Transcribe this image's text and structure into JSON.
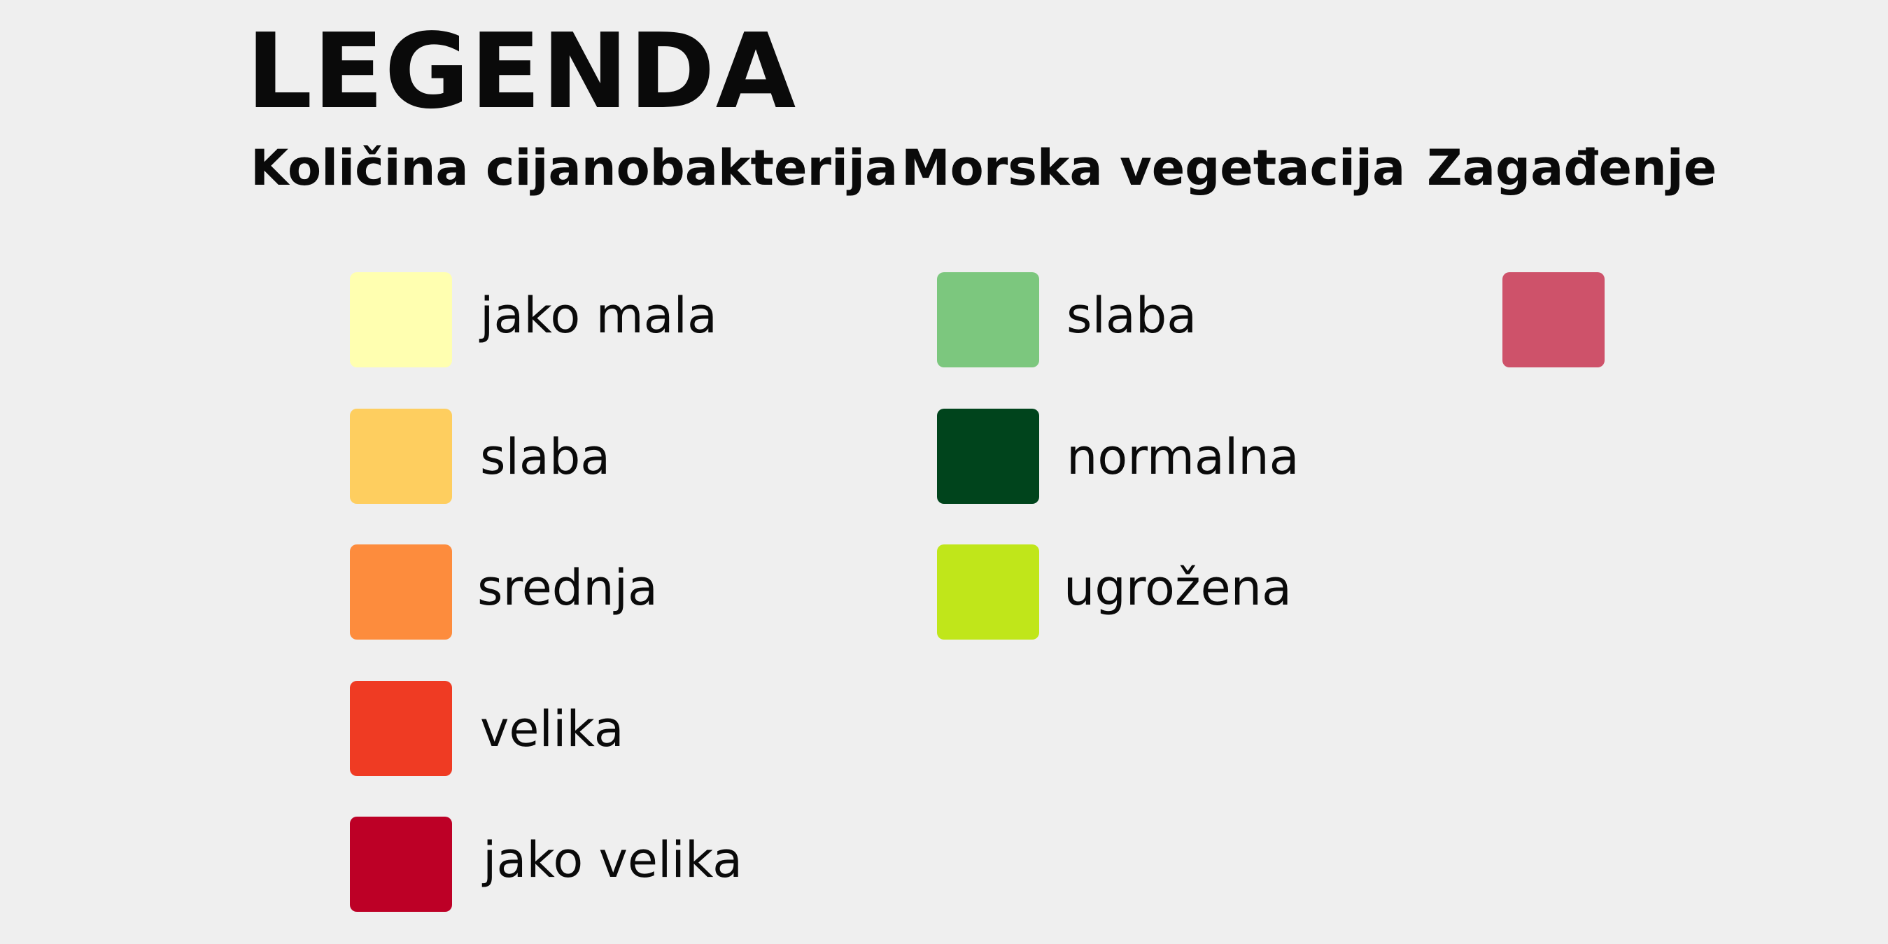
{
  "title": "LEGENDA",
  "groups": [
    {
      "heading": "Količina cijanobakterija",
      "items": [
        {
          "label": "jako mala",
          "color": "#ffffb0"
        },
        {
          "label": "slaba",
          "color": "#fece5f"
        },
        {
          "label": "srednja",
          "color": "#fd8c3d"
        },
        {
          "label": "velika",
          "color": "#ef3b23"
        },
        {
          "label": "jako velika",
          "color": "#bd0026"
        }
      ]
    },
    {
      "heading": "Morska vegetacija",
      "items": [
        {
          "label": "slaba",
          "color": "#7cc77e"
        },
        {
          "label": "normalna",
          "color": "#00441c"
        },
        {
          "label": "ugrožena",
          "color": "#c0e61a"
        }
      ]
    },
    {
      "heading": "Zagađenje",
      "items": [
        {
          "label": "",
          "color": "#ce526a"
        }
      ]
    }
  ]
}
